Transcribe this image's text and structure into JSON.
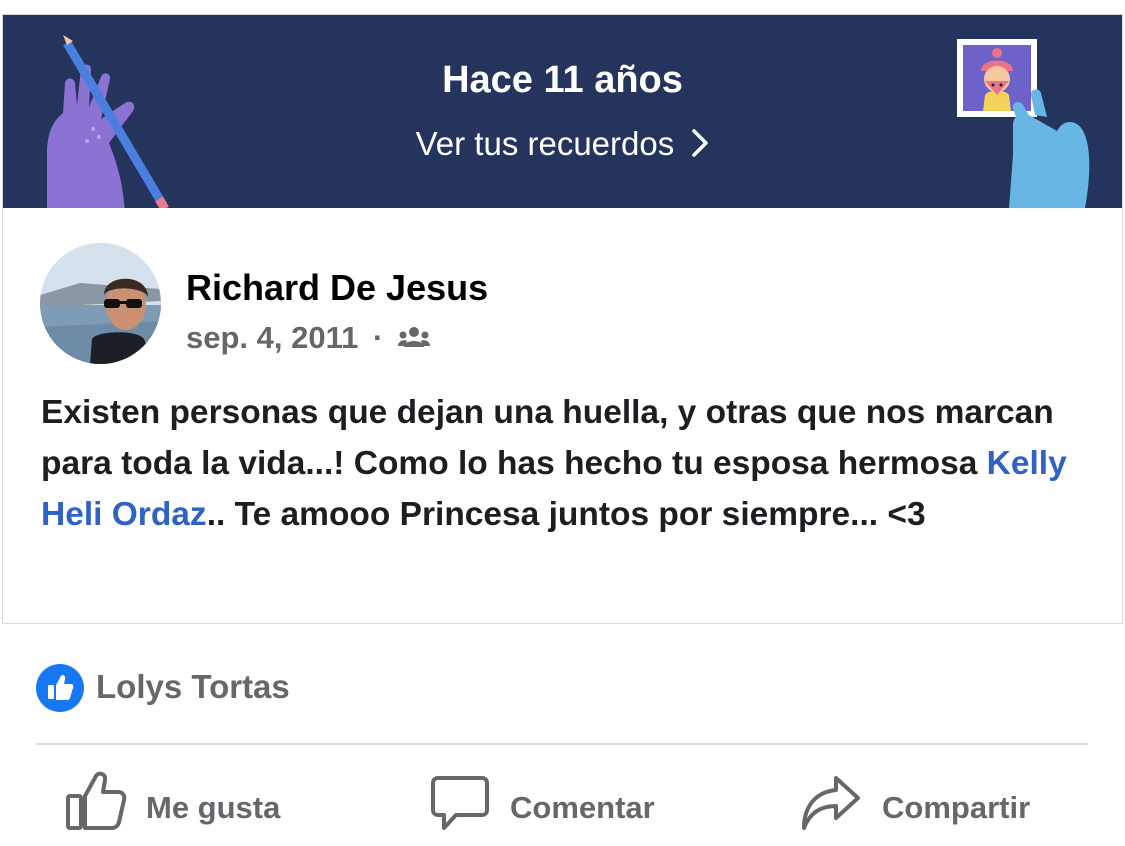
{
  "memory": {
    "title": "Hace 11 años",
    "link_label": "Ver tus recuerdos"
  },
  "post": {
    "author": "Richard De Jesus",
    "date": "sep. 4, 2011",
    "separator": "·",
    "audience_icon": "friends-icon",
    "text_before": "Existen personas que dejan una huella, y otras que nos marcan para toda la vida...! Como lo has hecho tu esposa hermosa ",
    "mention": "Kelly Heli Ordaz",
    "text_after": ".. Te amooo Princesa juntos por siempre... <3"
  },
  "reactions": {
    "icon": "like-icon",
    "liked_by": "Lolys Tortas"
  },
  "actions": {
    "like": "Me gusta",
    "comment": "Comentar",
    "share": "Compartir"
  },
  "colors": {
    "banner": "#24345c",
    "mention": "#2f62c3",
    "like_badge": "#1877f2",
    "muted_text": "#65676b"
  }
}
